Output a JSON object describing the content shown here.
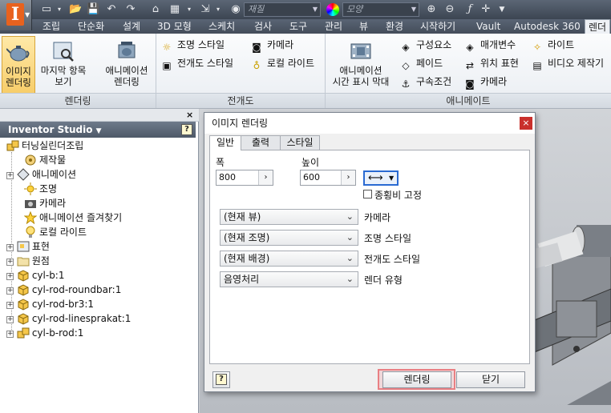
{
  "quick_access": {
    "material_placeholder": "재질",
    "appearance_placeholder": "모양"
  },
  "ribbon_tabs": [
    "조립",
    "단순화",
    "설계",
    "3D 모형",
    "스케치",
    "검사",
    "도구",
    "관리",
    "뷰",
    "환경",
    "시작하기",
    "Vault",
    "Autodesk 360",
    "렌더"
  ],
  "ribbon": {
    "render_panel": {
      "title": "렌더링",
      "render_image": "이미지\n렌더링",
      "last_render": "마지막 항목\n보기",
      "render_animation": "애니메이션\n렌더링"
    },
    "scene_panel": {
      "title": "전개도",
      "lighting_style": "조명 스타일",
      "scene_style": "전개도 스타일",
      "camera": "카메라",
      "local_lights": "로컬 라이트"
    },
    "animate_panel": {
      "title": "애니메이트",
      "timeline": "애니메이션\n시간 표시 막대",
      "components": "구성요소",
      "fade": "페이드",
      "constraints": "구속조건",
      "parameters": "매개변수",
      "positional_reps": "위치 표현",
      "camera": "카메라",
      "light": "라이트",
      "video_producer": "비디오 제작기"
    }
  },
  "browser": {
    "title": "Inventor Studio",
    "items": [
      {
        "label": "터닝실린더조립",
        "icon": "assembly-icon"
      },
      {
        "label": "제작물",
        "icon": "productions-icon"
      },
      {
        "label": "애니메이션",
        "icon": "animation-icon"
      },
      {
        "label": "조명",
        "icon": "lighting-icon"
      },
      {
        "label": "카메라",
        "icon": "camera-icon"
      },
      {
        "label": "애니메이션 즐겨찾기",
        "icon": "favorites-star-icon"
      },
      {
        "label": "로컬 라이트",
        "icon": "bulb-icon"
      },
      {
        "label": "표현",
        "icon": "representations-icon"
      },
      {
        "label": "원점",
        "icon": "origin-folder-icon"
      },
      {
        "label": "cyl-b:1",
        "icon": "part-icon"
      },
      {
        "label": "cyl-rod-roundbar:1",
        "icon": "part-icon"
      },
      {
        "label": "cyl-rod-br3:1",
        "icon": "part-icon"
      },
      {
        "label": "cyl-rod-linesprakat:1",
        "icon": "part-icon"
      },
      {
        "label": "cyl-b-rod:1",
        "icon": "subassembly-icon"
      }
    ]
  },
  "dialog": {
    "title": "이미지 렌더링",
    "tabs": [
      "일반",
      "출력",
      "스타일"
    ],
    "width_label": "폭",
    "height_label": "높이",
    "width_value": "800",
    "height_value": "600",
    "lock_aspect_label": "종횡비 고정",
    "rows": [
      {
        "value": "(현재 뷰)",
        "label": "카메라"
      },
      {
        "value": "(현재 조명)",
        "label": "조명 스타일"
      },
      {
        "value": "(현재 배경)",
        "label": "전개도 스타일"
      },
      {
        "value": "음영처리",
        "label": "렌더 유형"
      }
    ],
    "render_button": "렌더링",
    "close_button": "닫기"
  }
}
